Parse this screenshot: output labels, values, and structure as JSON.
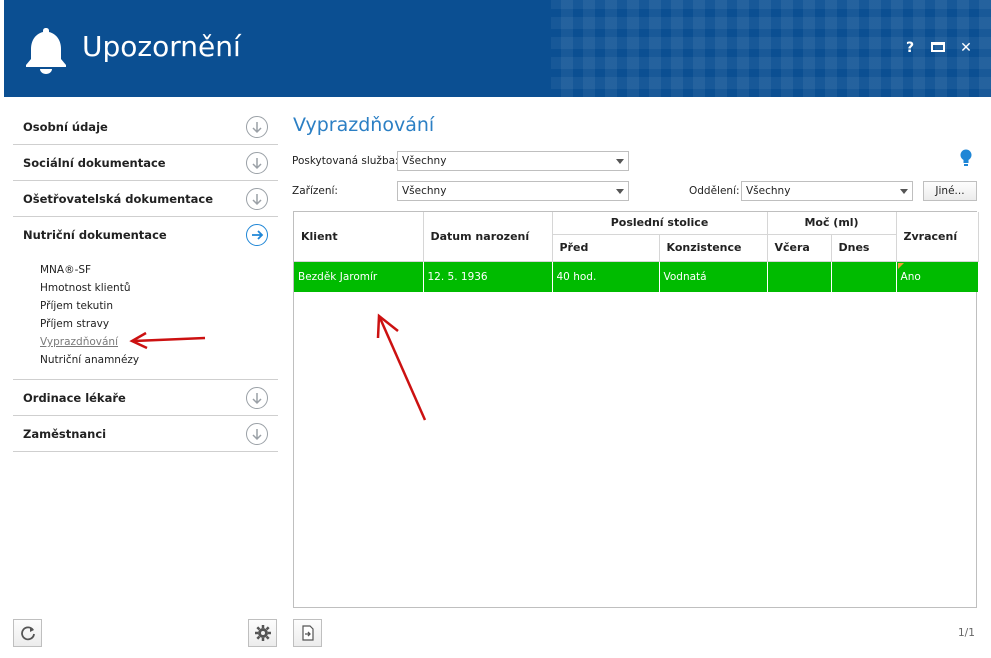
{
  "window": {
    "title": "Upozornění",
    "help_label": "?",
    "close_label": "✕"
  },
  "sidebar": {
    "items": [
      {
        "label": "Osobní údaje"
      },
      {
        "label": "Sociální dokumentace"
      },
      {
        "label": "Ošetřovatelská dokumentace"
      },
      {
        "label": "Nutriční dokumentace"
      },
      {
        "label": "Ordinace lékaře"
      },
      {
        "label": "Zaměstnanci"
      }
    ],
    "submenu": [
      "MNA®-SF",
      "Hmotnost klientů",
      "Příjem tekutin",
      "Příjem stravy",
      "Vyprazdňování",
      "Nutriční anamnézy"
    ]
  },
  "main": {
    "title": "Vyprazdňování",
    "filters": {
      "service_label": "Poskytovaná služba:",
      "service_value": "Všechny",
      "facility_label": "Zařízení:",
      "facility_value": "Všechny",
      "department_label": "Oddělení:",
      "department_value": "Všechny",
      "other_button": "Jiné..."
    },
    "table": {
      "headers": {
        "client": "Klient",
        "birth_date": "Datum narození",
        "last_stool": "Poslední stolice",
        "before": "Před",
        "consistency": "Konzistence",
        "urine": "Moč (ml)",
        "yesterday": "Včera",
        "today": "Dnes",
        "vomiting": "Zvracení"
      },
      "rows": [
        {
          "client": "Bezděk Jaromír",
          "birth_date": "12. 5. 1936",
          "before": "40 hod.",
          "consistency": "Vodnatá",
          "yesterday": "",
          "today": "",
          "vomiting": "Ano"
        }
      ]
    },
    "pager": "1/1"
  },
  "colors": {
    "header_bg": "#0b4f92",
    "accent": "#2b7fc4",
    "row_highlight": "#00bb00",
    "annotation_arrow": "#cc1111"
  }
}
